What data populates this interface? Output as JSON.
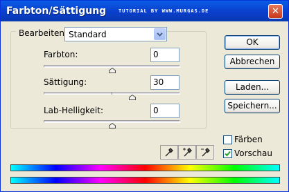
{
  "window": {
    "title": "Farbton/Sättigung",
    "watermark": "TUTORIAL BY WWW.MURGAS.DE",
    "close_label": "✕"
  },
  "edit": {
    "label": "Bearbeiten:",
    "selected": "Standard"
  },
  "sliders": [
    {
      "label": "Farbton:",
      "value": "0",
      "level": 0.5
    },
    {
      "label": "Sättigung:",
      "value": "30",
      "level": 0.65
    },
    {
      "label": "Lab-Helligkeit:",
      "value": "0",
      "level": 0.5
    }
  ],
  "buttons": {
    "ok": "OK",
    "cancel": "Abbrechen",
    "load": "Laden...",
    "save": "Speichern..."
  },
  "options": {
    "colorize": {
      "label": "Färben",
      "checked": false
    },
    "preview": {
      "label": "Vorschau",
      "checked": true
    }
  },
  "eyedroppers": [
    "eyedropper-icon",
    "eyedropper-plus-icon",
    "eyedropper-minus-icon"
  ],
  "colors": {
    "title_bar": "#0a4fd6",
    "dialog_bg": "#ece9d8",
    "checkmark": "#21a121"
  }
}
